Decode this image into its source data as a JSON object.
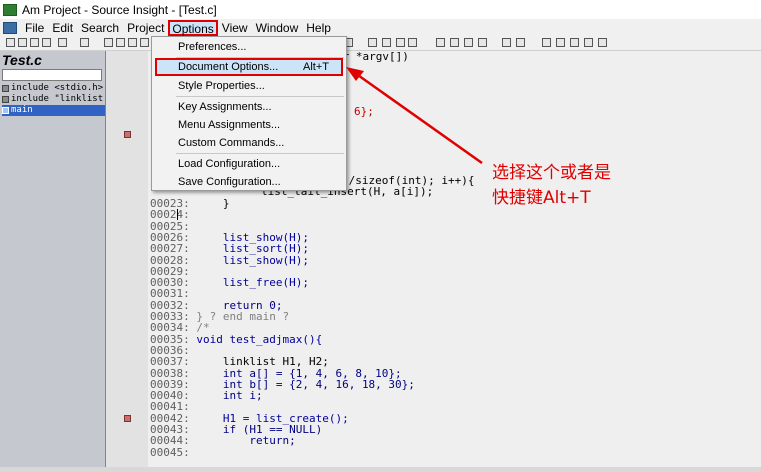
{
  "window": {
    "title": "Am Project - Source Insight - [Test.c]"
  },
  "menubar": {
    "items": [
      {
        "label": "File"
      },
      {
        "label": "Edit"
      },
      {
        "label": "Search"
      },
      {
        "label": "Project"
      },
      {
        "label": "Options"
      },
      {
        "label": "View"
      },
      {
        "label": "Window"
      },
      {
        "label": "Help"
      }
    ]
  },
  "options_menu": {
    "items": [
      {
        "label": "Preferences...",
        "shortcut": ""
      },
      {
        "label": "Document Options...",
        "shortcut": "Alt+T"
      },
      {
        "label": "Style Properties...",
        "shortcut": ""
      },
      {
        "label": "Key Assignments...",
        "shortcut": ""
      },
      {
        "label": "Menu Assignments...",
        "shortcut": ""
      },
      {
        "label": "Custom Commands...",
        "shortcut": ""
      },
      {
        "label": "Load Configuration...",
        "shortcut": ""
      },
      {
        "label": "Save Configuration...",
        "shortcut": ""
      }
    ]
  },
  "symbol_panel": {
    "file_title": "Test.c",
    "symbols": [
      {
        "label": "include <stdio.h>"
      },
      {
        "label": "include \"linklist.h"
      },
      {
        "label": "main"
      }
    ]
  },
  "code": {
    "partial_behind_menu": [
      {
        "text": "ar *argv[])"
      },
      {
        "text": "6};"
      },
      {
        "text": ")/sizeof(int); i++){"
      },
      {
        "text": "list_tail_insert(H, a[i]);"
      }
    ],
    "lines": [
      {
        "ln": "00023:",
        "text": "    }"
      },
      {
        "ln": "00024:",
        "text": ""
      },
      {
        "ln": "00025:",
        "text": ""
      },
      {
        "ln": "00026:",
        "text": "    list_show(H);"
      },
      {
        "ln": "00027:",
        "text": "    list_sort(H);"
      },
      {
        "ln": "00028:",
        "text": "    list_show(H);"
      },
      {
        "ln": "00029:",
        "text": ""
      },
      {
        "ln": "00030:",
        "text": "    list_free(H);"
      },
      {
        "ln": "00031:",
        "text": ""
      },
      {
        "ln": "00032:",
        "text": "    return 0;"
      },
      {
        "ln": "00033:",
        "text": "} ? end main ?"
      },
      {
        "ln": "00034:",
        "text": "/*"
      },
      {
        "ln": "00035:",
        "text": "void test_adjmax(){"
      },
      {
        "ln": "00036:",
        "text": ""
      },
      {
        "ln": "00037:",
        "text": "    linklist H1, H2;"
      },
      {
        "ln": "00038:",
        "text": "    int a[] = {1, 4, 6, 8, 10};"
      },
      {
        "ln": "00039:",
        "text": "    int b[] = {2, 4, 16, 18, 30};"
      },
      {
        "ln": "00040:",
        "text": "    int i;"
      },
      {
        "ln": "00041:",
        "text": ""
      },
      {
        "ln": "00042:",
        "text": "    H1 = list_create();"
      },
      {
        "ln": "00043:",
        "text": "    if (H1 == NULL)"
      },
      {
        "ln": "00044:",
        "text": "        return;"
      },
      {
        "ln": "00045:",
        "text": ""
      }
    ]
  },
  "annotation": {
    "line1": "选择这个或者是",
    "line2": "快捷键Alt+T",
    "color": "#e00000"
  },
  "colors": {
    "highlight_border": "#e00000",
    "menu_highlight": "#cce4f7",
    "selected_symbol": "#3163c5"
  }
}
